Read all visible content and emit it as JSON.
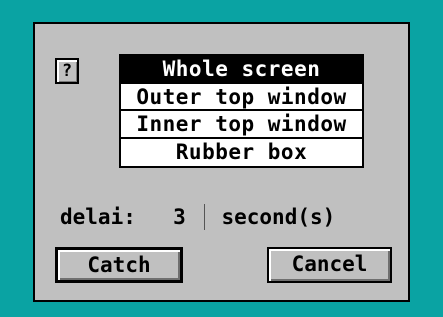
{
  "dialog": {
    "help_label": "?",
    "options": [
      {
        "label": "Whole screen",
        "selected": true
      },
      {
        "label": "Outer top window",
        "selected": false
      },
      {
        "label": "Inner top window",
        "selected": false
      },
      {
        "label": "Rubber box",
        "selected": false
      }
    ],
    "delay": {
      "label": "delai:",
      "value": "3",
      "unit": "second(s)"
    },
    "buttons": {
      "catch": "Catch",
      "cancel": "Cancel"
    }
  },
  "colors": {
    "desktop": "#0aa3a3",
    "dialog_bg": "#c0c0c0",
    "selection_bg": "#000000",
    "selection_fg": "#ffffff"
  }
}
